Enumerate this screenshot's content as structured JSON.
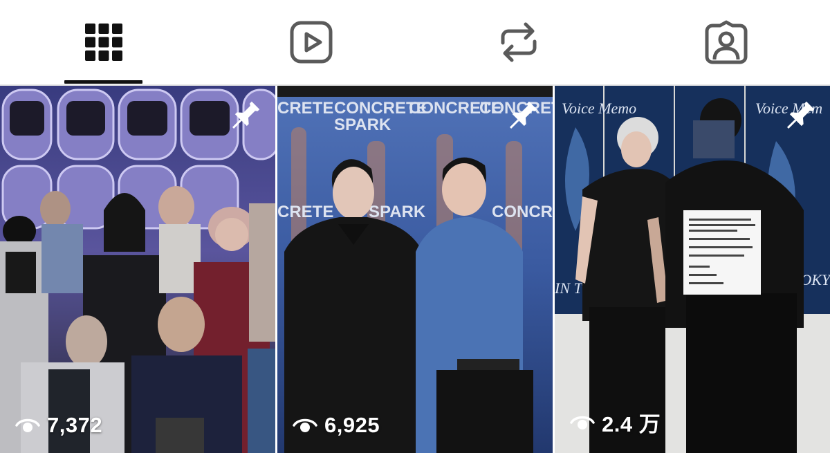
{
  "tabs": [
    {
      "id": "posts",
      "icon": "grid-icon",
      "active": true
    },
    {
      "id": "reels",
      "icon": "reels-play-icon",
      "active": false
    },
    {
      "id": "reposts",
      "icon": "repost-icon",
      "active": false
    },
    {
      "id": "tagged",
      "icon": "tagged-person-icon",
      "active": false
    }
  ],
  "posts": [
    {
      "views": "7,372",
      "pinned": true,
      "icon_pin": "pin-icon",
      "icon_views": "eye-icon"
    },
    {
      "views": "6,925",
      "pinned": true,
      "icon_pin": "pin-icon",
      "icon_views": "eye-icon"
    },
    {
      "views": "2.4 万",
      "pinned": true,
      "icon_pin": "pin-icon",
      "icon_views": "eye-icon"
    }
  ],
  "colors": {
    "icon_active": "#111111",
    "icon_inactive": "#5a5a5a",
    "divider": "#e6e6e6"
  }
}
